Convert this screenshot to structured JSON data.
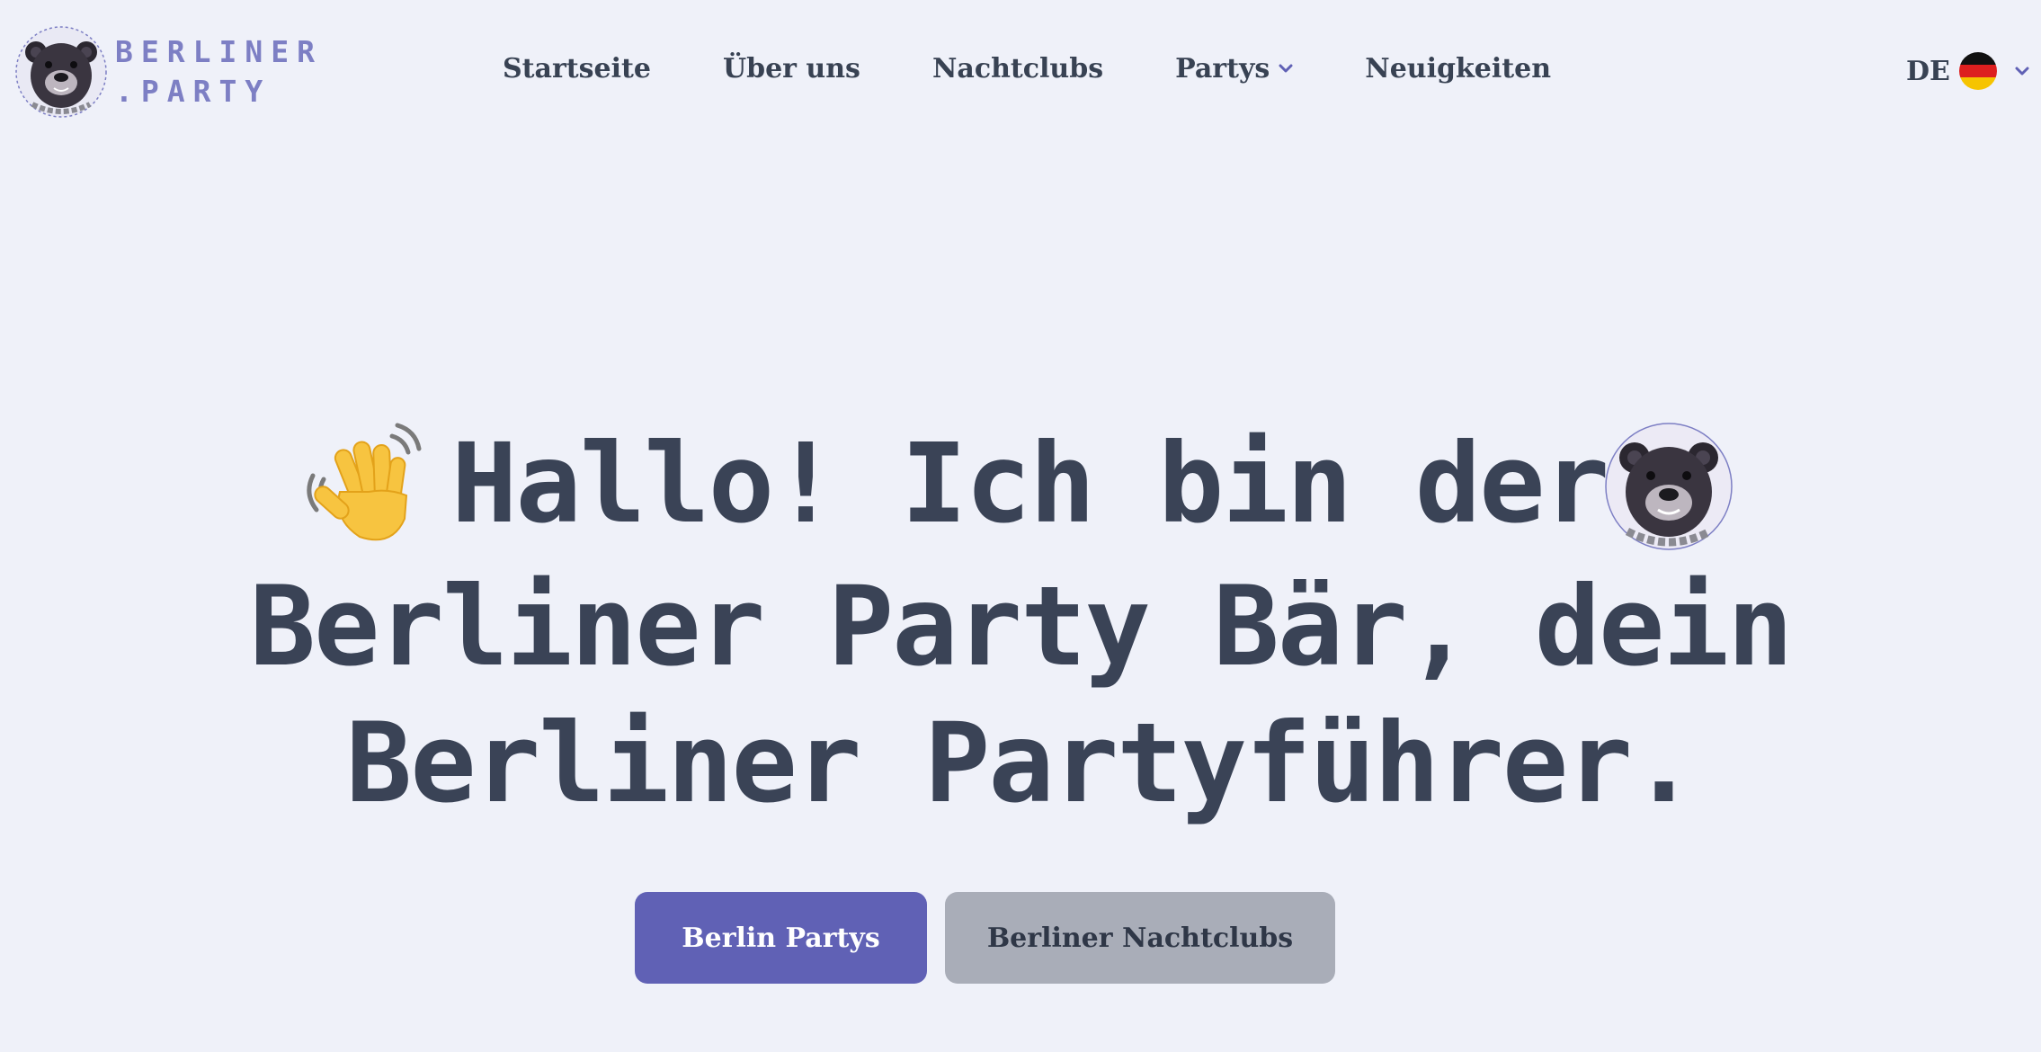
{
  "header": {
    "logo_line1": "BERLINER",
    "logo_line2": ".PARTY",
    "nav": [
      {
        "label": "Startseite"
      },
      {
        "label": "Über uns"
      },
      {
        "label": "Nachtclubs"
      },
      {
        "label": "Partys",
        "has_dropdown": true
      },
      {
        "label": "Neuigkeiten"
      }
    ],
    "language": {
      "code": "DE",
      "flag_icon": "germany-flag-icon"
    }
  },
  "hero": {
    "line1": "Hallo! Ich bin der",
    "line2": "Berliner Party Bär, dein",
    "line3": "Berliner Partyführer.",
    "icons": [
      "waving-hand-icon",
      "bear-avatar-icon"
    ]
  },
  "cta": {
    "primary_label": "Berlin Partys",
    "secondary_label": "Berliner Nachtclubs"
  },
  "colors": {
    "background": "#eff1f9",
    "text": "#384253",
    "accent": "#6061b5",
    "logo": "#7d7fc4",
    "secondary_button": "#a9adb8"
  }
}
